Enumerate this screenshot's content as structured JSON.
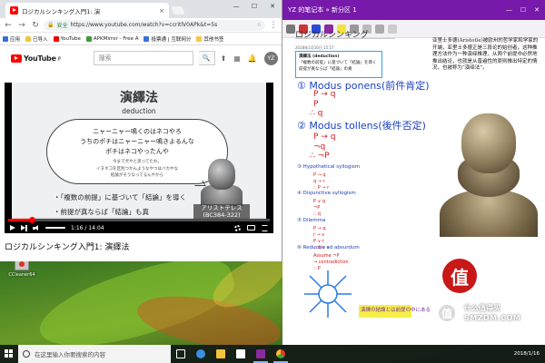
{
  "desktop": {
    "icon_label": "CCleaner64"
  },
  "chrome": {
    "tab_title": "ロジカルシンキング入門1: 演",
    "tab_close": "×",
    "window_controls": [
      "—",
      "☐",
      "✕"
    ],
    "secure_label": "安全",
    "url": "https://www.youtube.com/watch?v=ccritlV0APk&t=5s",
    "bookmarks": [
      {
        "label": "应用",
        "color": "blue"
      },
      {
        "label": "已导入",
        "color": "yellow"
      },
      {
        "label": "YouTube",
        "color": "red"
      },
      {
        "label": "APKMirror - Free A",
        "color": "green"
      },
      {
        "label": "投票通 | 互联网分",
        "color": "blue"
      },
      {
        "label": "其他书签",
        "color": "yellow"
      }
    ]
  },
  "youtube": {
    "logo_text": "YouTube",
    "logo_sup": "JP",
    "search_placeholder": "搜索",
    "avatar_initials": "YZ",
    "video_title": "ロジカルシンキング入門1: 演繹法",
    "player": {
      "time": "1:16 / 14:04",
      "progress_fraction": 0.09
    },
    "slide": {
      "title": "演繹法",
      "subtitle": "deduction",
      "bubble_line1": "ニャーニャー鳴くのはネコやろ",
      "bubble_line2": "うちのポチはニャーニャー鳴きよるんな",
      "bubble_line3": "ポチはネコやったんや",
      "bubble_small1": "今まで犬やと思ってたわ。",
      "bubble_small2": "イヌネコを区別つかんようなやつはバカやな",
      "bubble_small3": "結論がそうなってるんやから",
      "bullet1": "・「複数の前提」に基づいて「結論」を導く",
      "bullet2": "・前提が真ならば「結論」も真",
      "caption_name": "アリストテレス",
      "caption_years": "(BC384-322)"
    }
  },
  "onenote": {
    "window_title": "YZ 的笔记本 » 新分区 1",
    "page_title": "ロジカルシンキング",
    "date": "2018年1月16日 15:57",
    "note_box": {
      "line1": "演繹法 (deduction)",
      "line2": "「複数の前提」に基づいて「結論」を導く",
      "line3": "前提が真ならば「結論」の真"
    },
    "right_text": "亚里士多德(Aristotle)被欧州的哲学家和学家的开端，亚里士多德正是三段论的始创者，这种推理方法作为一种演绎推理，从两个前提中必然地推出结论，也就是从普遍性的原则推出特定的情况，也被称为“演绎法”。",
    "handwriting": [
      {
        "text": "① Modus ponens(前件肯定)",
        "color": "blue"
      },
      {
        "text": "P → q",
        "color": "red"
      },
      {
        "text": "P",
        "color": "red"
      },
      {
        "text": "∴ q",
        "color": "red"
      },
      {
        "text": "② Modus tollens(後件否定)",
        "color": "blue"
      },
      {
        "text": "P → q",
        "color": "red"
      },
      {
        "text": "¬q",
        "color": "red"
      },
      {
        "text": "∴ ¬P",
        "color": "red"
      },
      {
        "text": "③ Hypothetical syllogism",
        "color": "blue"
      },
      {
        "text": "④ Disjunctive syllogism",
        "color": "blue"
      },
      {
        "text": "⑤ Dilemma",
        "color": "blue"
      },
      {
        "text": "⑥ Reductio ad absurdum",
        "color": "blue"
      },
      {
        "text": "演繹の結論とは前提の中にある",
        "color": "purple"
      }
    ],
    "stamp_char": "值"
  },
  "watermark": {
    "logo_char": "值",
    "cn": "什么值得买",
    "en": "SMZDM.COM"
  },
  "taskbar": {
    "search_placeholder": "在这里输入你要搜索的内容",
    "clock": "2018/1/16"
  }
}
